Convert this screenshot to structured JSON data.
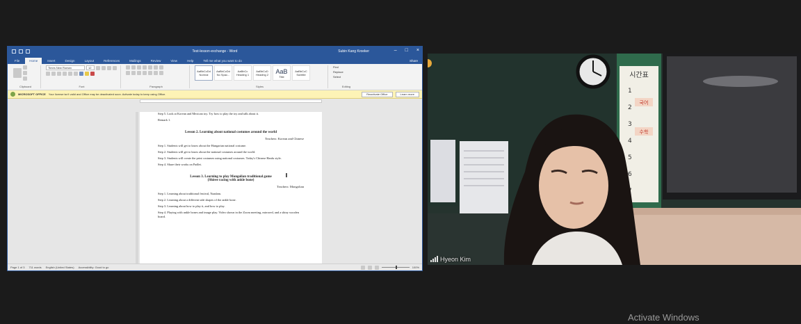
{
  "desktop": {
    "watermark": "Activate Windows"
  },
  "word": {
    "title": "Test-lesson-exchange - Word",
    "user": "Subin Kang Kroeker",
    "tabs": [
      "File",
      "Home",
      "Insert",
      "Design",
      "Layout",
      "References",
      "Mailings",
      "Review",
      "View",
      "Help"
    ],
    "active_tab": "Home",
    "tell_me": "Tell me what you want to do",
    "share": "Share",
    "font_name": "Times New Roman",
    "font_size": "12",
    "ribbon_groups": [
      "Clipboard",
      "Font",
      "Paragraph",
      "Styles",
      "Editing"
    ],
    "styles": [
      {
        "preview": "AaBbCcDd",
        "name": "Normal"
      },
      {
        "preview": "AaBbCcDd",
        "name": "No Spac..."
      },
      {
        "preview": "AaBbCc",
        "name": "Heading 1"
      },
      {
        "preview": "AaBbCcD",
        "name": "Heading 2"
      },
      {
        "preview": "AaB",
        "name": "Title"
      },
      {
        "preview": "AaBbCcC",
        "name": "Subtitle"
      }
    ],
    "editing": [
      "Find",
      "Replace",
      "Select"
    ],
    "message_bar": {
      "title": "MICROSOFT OFFICE",
      "text": "Your license isn't valid and Office may be deactivated soon. Activate today to keep using Office.",
      "button_primary": "Reactivate Office",
      "button_secondary": "Learn more"
    },
    "document": {
      "intro_lines": [
        "Step 5. Look at Korean and Mexican toy. Try how to play the toy and talk about it.",
        "Remark 1."
      ],
      "lesson2": {
        "heading": "Lesson 2. Learning about national costumes around the world",
        "teachers": "Teachers: Korean and Chinese",
        "steps": [
          "Step 1. Students will get to know about the Hungarian national costume.",
          "Step 2. Students will get to know about the national costumes around the world.",
          "Step 3. Students will create the print costumes using national costumes. Today's Chinese Hanfu style.",
          "Step 4. Share their works on Padlet."
        ]
      },
      "lesson3": {
        "heading": "Lesson 3. Learning to play Mongolian traditional game",
        "subheading": "(Shiree racing with ankle bone)",
        "teachers": "Teachers: Mongolian",
        "steps": [
          "Step 1. Learning about traditional festival, Naadam.",
          "Step 2. Learning about a different side shapes of the ankle bone.",
          "Step 3. Learning about how to play it, and how to play.",
          "Step 4. Playing with ankle bones and image play. Video shown in the Zoom meeting, mirrored, and a shiny wooden board."
        ]
      }
    },
    "status": {
      "page": "Page 1 of 3",
      "words": "711 words",
      "language": "English (United States)",
      "accessibility": "Accessibility: Good to go",
      "zoom": "100%"
    }
  },
  "video": {
    "participant": "Hyeon Kim",
    "chart_labels": [
      "시간표",
      "국어",
      "수학"
    ],
    "period_numbers": [
      "1",
      "2",
      "3",
      "4",
      "5",
      "6",
      "7"
    ]
  }
}
